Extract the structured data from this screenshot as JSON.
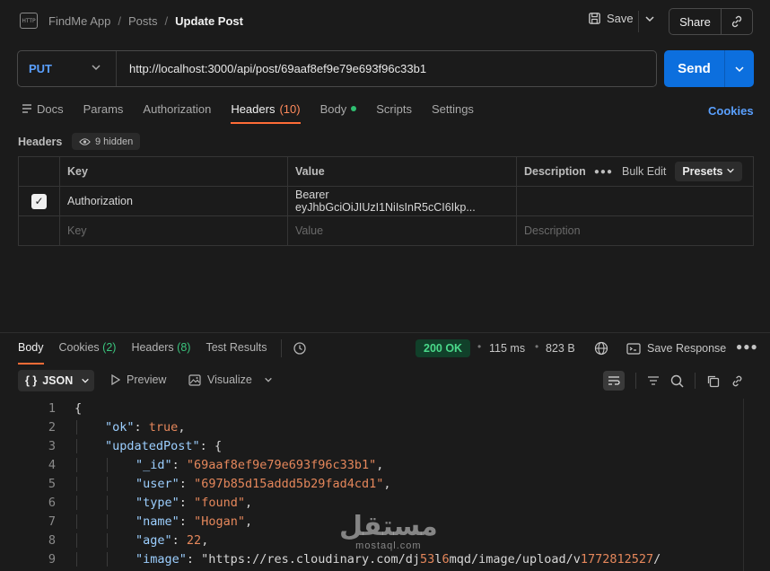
{
  "breadcrumb": {
    "workspace": "FindMe App",
    "folder": "Posts",
    "current": "Update Post",
    "separator": "/"
  },
  "toolbar": {
    "save_label": "Save",
    "share_label": "Share"
  },
  "request": {
    "method": "PUT",
    "url": "http://localhost:3000/api/post/69aaf8ef9e79e693f96c33b1",
    "send_label": "Send"
  },
  "req_tabs": {
    "docs": "Docs",
    "params": "Params",
    "authorization": "Authorization",
    "headers": "Headers",
    "headers_count": "(10)",
    "body": "Body",
    "scripts": "Scripts",
    "settings": "Settings",
    "cookies": "Cookies"
  },
  "headers_section": {
    "label": "Headers",
    "hidden": "9 hidden",
    "columns": {
      "key": "Key",
      "value": "Value",
      "description": "Description"
    },
    "bulk_edit": "Bulk Edit",
    "presets": "Presets",
    "rows": [
      {
        "key": "Authorization",
        "value": "Bearer eyJhbGciOiJIUzI1NiIsInR5cCI6Ikp...",
        "description": ""
      }
    ],
    "placeholder": {
      "key": "Key",
      "value": "Value",
      "description": "Description"
    }
  },
  "resp_tabs": {
    "body": "Body",
    "cookies": "Cookies",
    "cookies_count": "(2)",
    "headers": "Headers",
    "headers_count": "(8)",
    "test_results": "Test Results"
  },
  "response_meta": {
    "status": "200 OK",
    "time": "115 ms",
    "size": "823 B",
    "save_response": "Save Response"
  },
  "view": {
    "format": "JSON",
    "preview": "Preview",
    "visualize": "Visualize"
  },
  "code_lines": [
    {
      "n": "1",
      "t": "{"
    },
    {
      "n": "2",
      "t": "\"ok\": true,"
    },
    {
      "n": "3",
      "t": "\"updatedPost\": {"
    },
    {
      "n": "4",
      "t": "\"_id\": \"69aaf8ef9e79e693f96c33b1\","
    },
    {
      "n": "5",
      "t": "\"user\": \"697b85d15addd5b29fad4cd1\","
    },
    {
      "n": "6",
      "t": "\"type\": \"found\","
    },
    {
      "n": "7",
      "t": "\"name\": \"Hogan\","
    },
    {
      "n": "8",
      "t": "\"age\": 22,"
    },
    {
      "n": "9",
      "t": "\"image\": \"https://res.cloudinary.com/dj53l6mqd/image/upload/v1772812527/"
    }
  ],
  "watermark": {
    "arabic": "مستقل",
    "latin": "mostaql.com"
  }
}
